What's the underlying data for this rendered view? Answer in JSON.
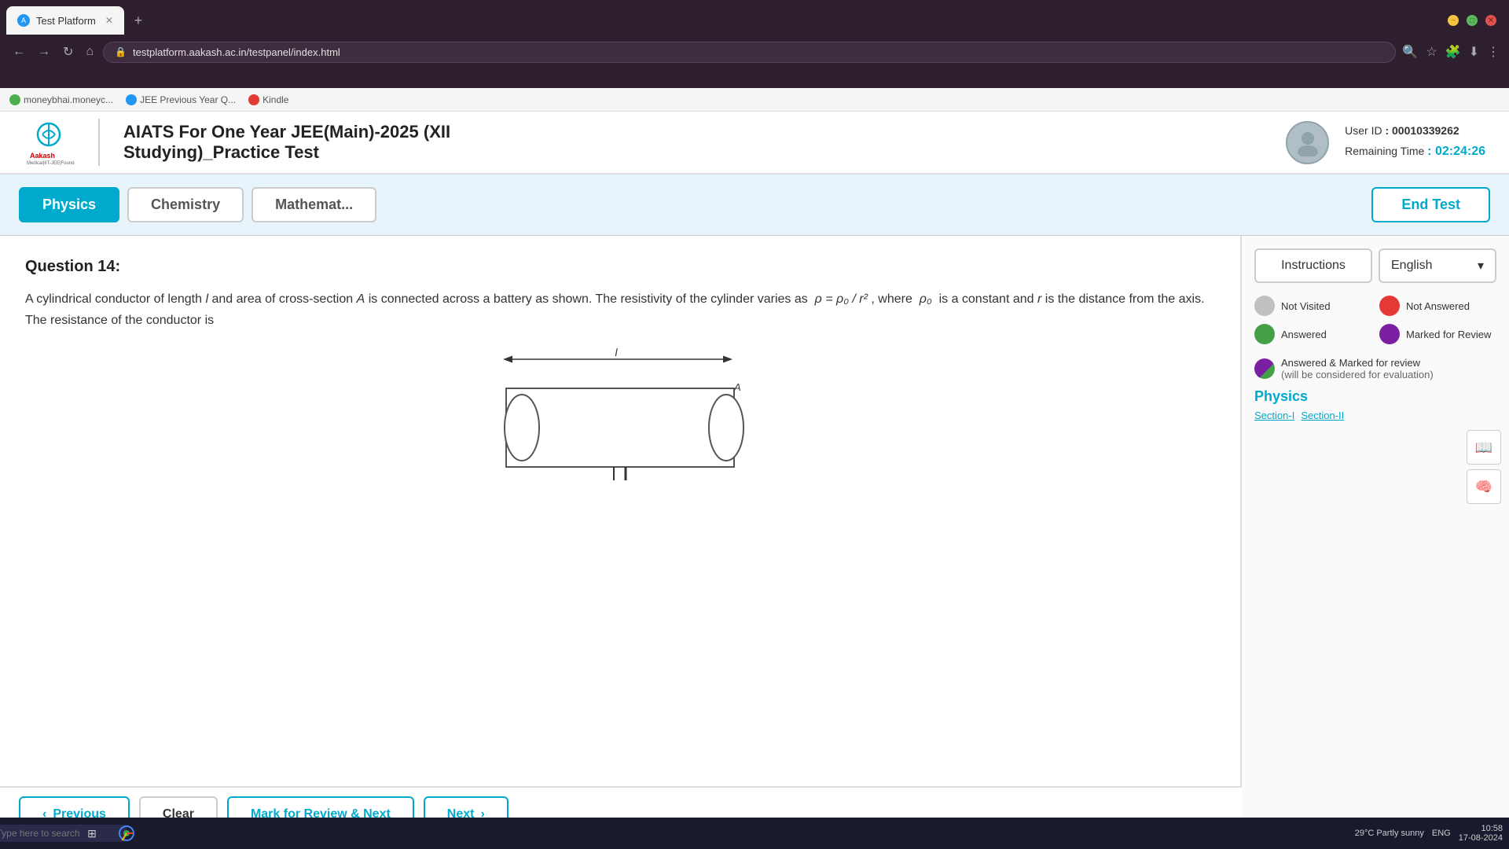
{
  "browser": {
    "tab_title": "Test Platform",
    "url": "testplatform.aakash.ac.in/testpanel/index.html",
    "bookmarks": [
      {
        "label": "moneybhai.moneyc...",
        "icon_color": "green"
      },
      {
        "label": "JEE Previous Year Q...",
        "icon_color": "blue"
      },
      {
        "label": "Kindle",
        "icon_color": "red"
      }
    ]
  },
  "header": {
    "logo_alt": "Aakash",
    "test_title_line1": "AIATS For One Year JEE(Main)-2025 (XII",
    "test_title_line2": "Studying)_Practice Test",
    "user_id_label": "User ID",
    "user_id_value": ": 00010339262",
    "remaining_time_label": "Remaining Time",
    "remaining_time_value": ": 02:24:26"
  },
  "subjects": [
    {
      "label": "Physics",
      "active": true
    },
    {
      "label": "Chemistry",
      "active": false
    },
    {
      "label": "Mathemat...",
      "active": false
    }
  ],
  "end_test_label": "End Test",
  "question": {
    "number_label": "Question 14:",
    "text_part1": "A cylindrical conductor of length ",
    "text_l": "l",
    "text_part2": " and area of cross-section ",
    "text_A": "A",
    "text_part3": " is connected across a battery as shown. The resistivity of the cylinder varies as ",
    "formula": "ρ = ρ₀ / r²",
    "text_part4": ", where ",
    "text_rho0": "ρ₀",
    "text_part5": " is a constant and ",
    "text_r": "r",
    "text_part6": " is the distance from the axis. The resistance of the conductor is"
  },
  "buttons": {
    "previous": "Previous",
    "clear": "Clear",
    "mark_review": "Mark for Review & Next",
    "next": "Next"
  },
  "right_panel": {
    "instructions_label": "Instructions",
    "language_label": "English",
    "legend": [
      {
        "color": "gray",
        "label": "Not Visited"
      },
      {
        "color": "red",
        "label": "Not Answered"
      },
      {
        "color": "green",
        "label": "Answered"
      },
      {
        "color": "purple",
        "label": "Marked for Review"
      }
    ],
    "answered_marked_label": "Answered & Marked for review",
    "answered_marked_sub": "(will be considered for evaluation)",
    "section_label": "Physics",
    "section_tabs": [
      "Section-I",
      "Section-II"
    ]
  },
  "taskbar": {
    "search_placeholder": "Type here to search",
    "weather": "29°C  Partly sunny",
    "language": "ENG",
    "time": "10:58",
    "date": "17-08-2024"
  }
}
